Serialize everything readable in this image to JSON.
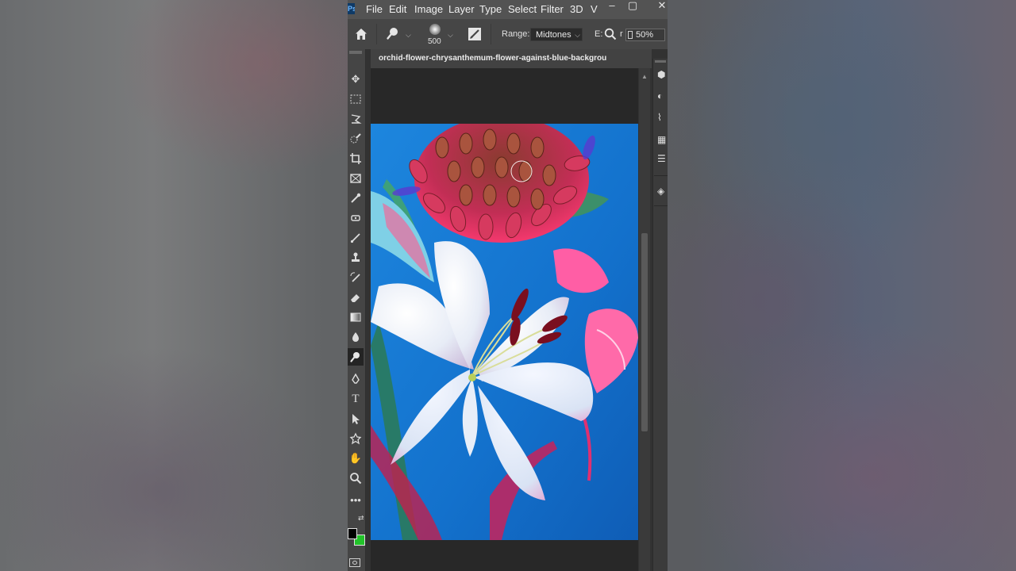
{
  "app": {
    "logo": "Ps",
    "menu": [
      "File",
      "Edit",
      "Image",
      "Layer",
      "Type",
      "Select",
      "Filter",
      "3D",
      "V"
    ],
    "window_controls": {
      "minimize": "–",
      "restore": "▢",
      "close": "✕"
    }
  },
  "options_bar": {
    "brush_size": "500",
    "range_label": "Range:",
    "range_value": "Midtones",
    "exposure_label": "E:",
    "exposure_partial": "r",
    "exposure_value": "50%"
  },
  "document": {
    "tab_title": "orchid-flower-chrysanthemum-flower-against-blue-backgrou"
  },
  "toolbar": {
    "active_tool": "dodge-tool",
    "tools": [
      "move",
      "rectangular-marquee",
      "lasso",
      "quick-selection",
      "crop",
      "frame",
      "eyedropper",
      "spot-healing-brush",
      "brush",
      "clone-stamp",
      "history-brush",
      "eraser",
      "gradient",
      "blur",
      "dodge",
      "pen",
      "type",
      "path-selection",
      "custom-shape",
      "hand",
      "zoom",
      "more-tools"
    ]
  },
  "colors": {
    "foreground": "#000000",
    "background": "#22c32a",
    "canvas_blue": "#1a77d2"
  }
}
